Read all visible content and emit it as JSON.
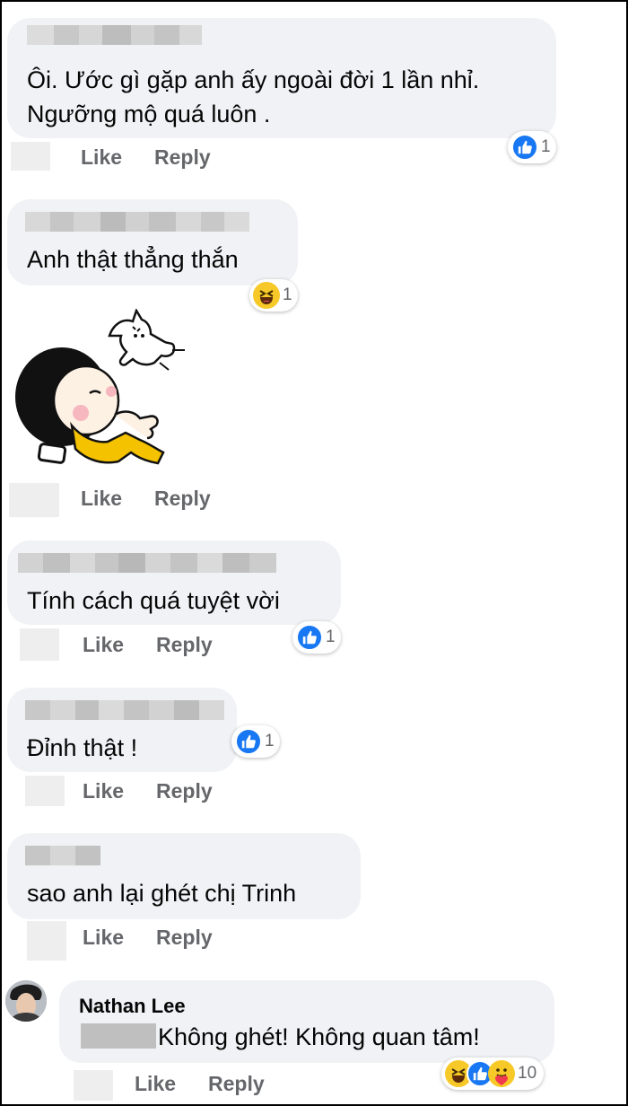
{
  "comments": [
    {
      "text_line1": "Ôi. Ước gì gặp anh ấy ngoài đời 1 lần nhỉ.",
      "text_line2": "Ngưỡng mộ quá luôn .",
      "reaction_count": "1",
      "reaction": "like-icon"
    },
    {
      "text": "Anh thật thẳng thắn",
      "reaction_count": "1",
      "reaction": "haha-icon"
    },
    {
      "sticker": "girl-and-cat-sticker"
    },
    {
      "text": "Tính cách quá tuyệt vời",
      "reaction_count": "1",
      "reaction": "like-icon"
    },
    {
      "text": "Đỉnh thật !",
      "reaction_count": "1",
      "reaction": "like-icon"
    },
    {
      "text": "sao anh lại ghét chị Trinh"
    },
    {
      "author": "Nathan Lee",
      "text": "Không ghét! Không quan tâm!",
      "reaction_count": "10",
      "reactions": [
        "haha-icon",
        "like-icon",
        "care-icon"
      ]
    }
  ],
  "actions": {
    "like": "Like",
    "reply": "Reply"
  },
  "colors": {
    "bubble": "#f0f2f5",
    "action_text": "#65676b",
    "like_blue": "#1877f2",
    "emoji_yellow": "#f7c928"
  }
}
